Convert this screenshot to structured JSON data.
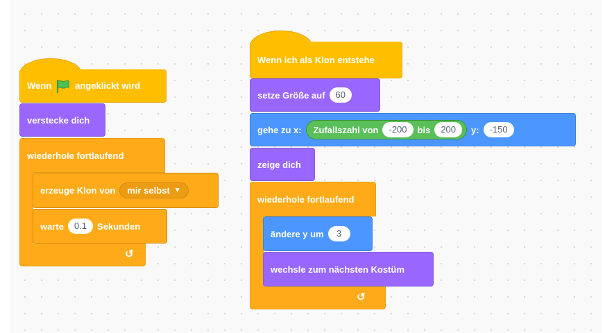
{
  "script1": {
    "hat": {
      "prefix": "Wenn",
      "suffix": "angeklickt wird",
      "flag_icon": "green-flag-icon"
    },
    "hide": "verstecke dich",
    "forever": "wiederhole fortlaufend",
    "create_clone": {
      "label": "erzeuge Klon von",
      "option": "mir selbst"
    },
    "wait": {
      "label": "warte",
      "value": "0.1",
      "unit": "Sekunden"
    }
  },
  "script2": {
    "hat": "Wenn ich als Klon entstehe",
    "set_size": {
      "label": "setze Größe auf",
      "value": "60"
    },
    "goto": {
      "label": "gehe zu x:",
      "random": {
        "label": "Zufallszahl von",
        "from": "-200",
        "to_label": "bis",
        "to": "200"
      },
      "y_label": "y:",
      "y": "-150"
    },
    "show": "zeige dich",
    "forever": "wiederhole fortlaufend",
    "change_y": {
      "label": "ändere y um",
      "value": "3"
    },
    "next_costume": "wechsle zum nächsten Kostüm"
  },
  "colors": {
    "events": "#ffbf00",
    "looks": "#9966ff",
    "control": "#ffab19",
    "motion": "#4c97ff",
    "operators": "#59c059"
  }
}
